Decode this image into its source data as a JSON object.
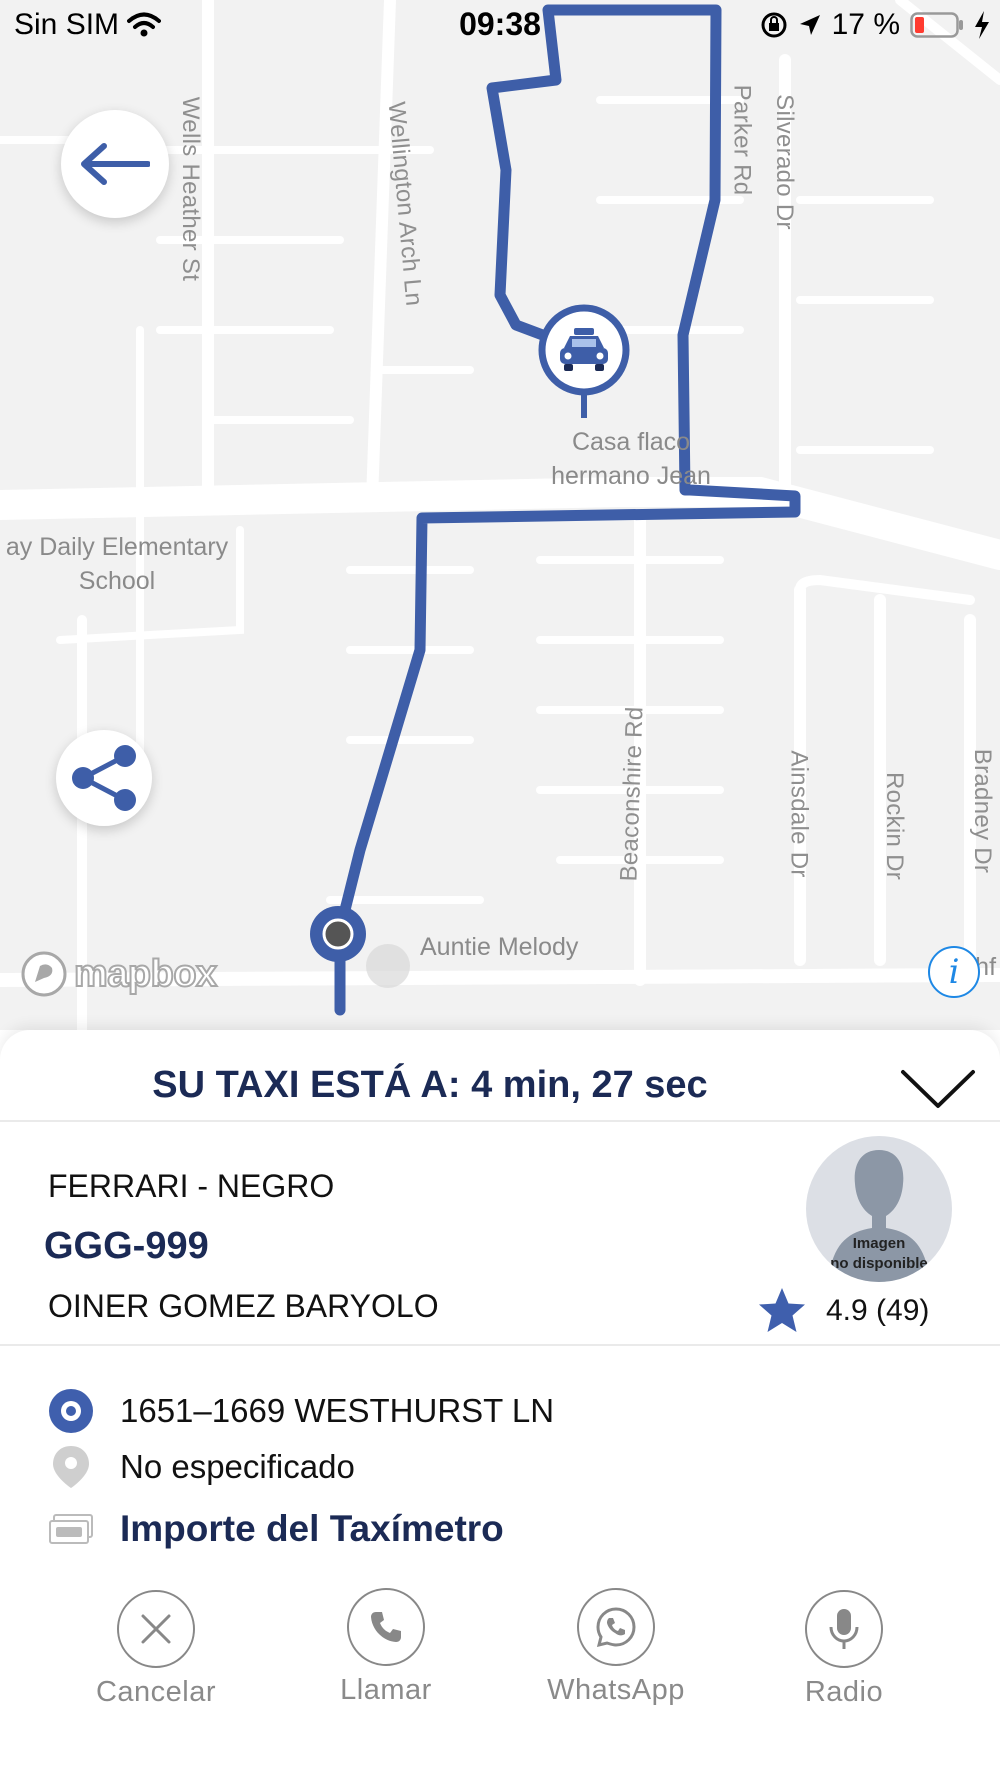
{
  "status_bar": {
    "carrier": "Sin SIM",
    "time": "09:38",
    "battery": "17 %"
  },
  "map": {
    "streets": [
      "Wells Heather St",
      "Wellington Arch Ln",
      "Silverado Dr",
      "Beaconshire Rd",
      "Ainsdale Dr",
      "Rockin Dr",
      "Bradney Dr",
      "Parker Rd"
    ],
    "poi": {
      "school": "ay Daily Elementary\nSchool",
      "casa": "Casa flaco\nhermano Jean",
      "auntie": "Auntie Melody",
      "edge": "Ashf"
    },
    "attribution": "mapbox"
  },
  "trip": {
    "eta_label": "SU TAXI ESTÁ A: 4 min, 27 sec",
    "vehicle": "FERRARI - NEGRO",
    "plate": "GGG-999",
    "driver_name": "OINER GOMEZ BARYOLO",
    "rating": "4.9 (49)",
    "avatar_text": "Imagen\nno disponible"
  },
  "route": {
    "origin": "1651–1669 WESTHURST LN",
    "destination": "No especificado",
    "fare_link": "Importe del Taxímetro"
  },
  "actions": {
    "cancel": "Cancelar",
    "call": "Llamar",
    "whatsapp": "WhatsApp",
    "radio": "Radio"
  },
  "colors": {
    "route_blue": "#3e5ea8",
    "navy_text": "#1b2a55",
    "accent_blue": "#3f5fad"
  },
  "icons": [
    "back-arrow-icon",
    "share-icon",
    "taxi-icon",
    "info-icon",
    "chevron-down-icon",
    "star-icon",
    "origin-dot-icon",
    "destination-pin-icon",
    "cash-icon",
    "close-icon",
    "phone-icon",
    "whatsapp-icon",
    "microphone-icon"
  ]
}
